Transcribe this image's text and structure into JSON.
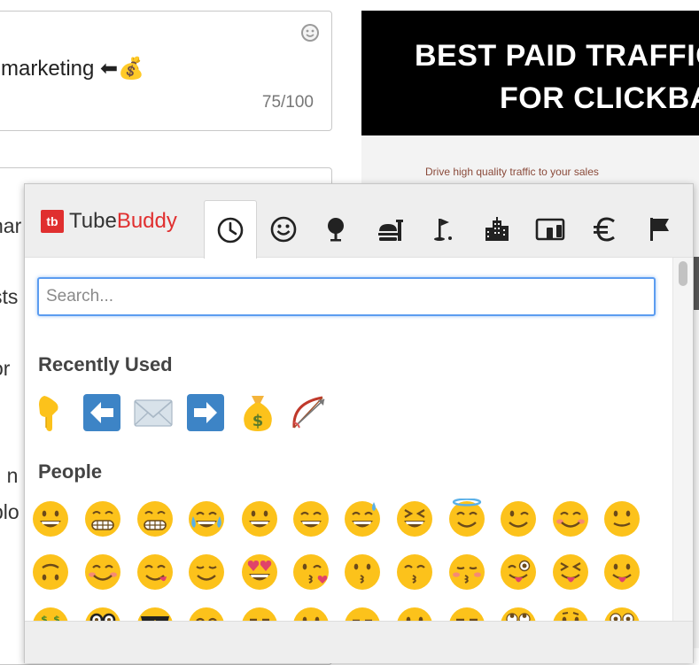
{
  "title_field": {
    "value": "marketing ⬅💰",
    "counter": "75/100"
  },
  "description_lines": [
    {
      "text": "nar"
    },
    {
      "text": "sts"
    },
    {
      "text": "or"
    },
    {
      "text": "il n"
    },
    {
      "text": "plo"
    }
  ],
  "thumbnail": {
    "headline_line1": "BEST PAID TRAFFIC",
    "headline_line2": "FOR CLICKBA",
    "subtext": "Drive high quality traffic to your sales"
  },
  "picker": {
    "brand_part1": "Tube",
    "brand_part2": "Buddy",
    "brand_mark": "tb",
    "categories": [
      {
        "icon": "clock-icon",
        "active": true
      },
      {
        "icon": "smiley-icon"
      },
      {
        "icon": "tree-icon"
      },
      {
        "icon": "food-icon"
      },
      {
        "icon": "golf-icon"
      },
      {
        "icon": "buildings-icon"
      },
      {
        "icon": "devices-icon"
      },
      {
        "icon": "euro-icon"
      },
      {
        "icon": "flag-icon"
      }
    ],
    "search_placeholder": "Search...",
    "recently_used_title": "Recently Used",
    "recently_used": [
      {
        "name": "pointing-down-emoji"
      },
      {
        "name": "left-arrow-emoji"
      },
      {
        "name": "envelope-emoji"
      },
      {
        "name": "right-arrow-emoji"
      },
      {
        "name": "money-bag-emoji"
      },
      {
        "name": "bow-and-arrow-emoji"
      }
    ],
    "people_title": "People",
    "people_rows": [
      [
        "grinning",
        "grimacing",
        "grimacing",
        "joy",
        "smiley",
        "smile",
        "sweat-smile",
        "laughing",
        "innocent",
        "wink",
        "blush",
        "slight-smile"
      ],
      [
        "upside-down",
        "relaxed",
        "yum",
        "relieved",
        "heart-eyes",
        "kissing-heart",
        "kissing",
        "kissing-smiling-eyes",
        "kissing-closed-eyes",
        "stuck-out-tongue-winking",
        "stuck-out-tongue-closed-eyes",
        "stuck-out-tongue"
      ],
      [
        "money-mouth",
        "nerd",
        "sunglasses",
        "smile",
        "smirk",
        "neutral",
        "expressionless",
        "no-mouth",
        "unamused",
        "rolling-eyes",
        "thinking",
        "flushed"
      ]
    ]
  },
  "colors": {
    "accent": "#5b9cf0",
    "brand_red": "#e02f2f",
    "emoji_yellow": "#fcc21b",
    "arrow_blue": "#3d84c6"
  }
}
